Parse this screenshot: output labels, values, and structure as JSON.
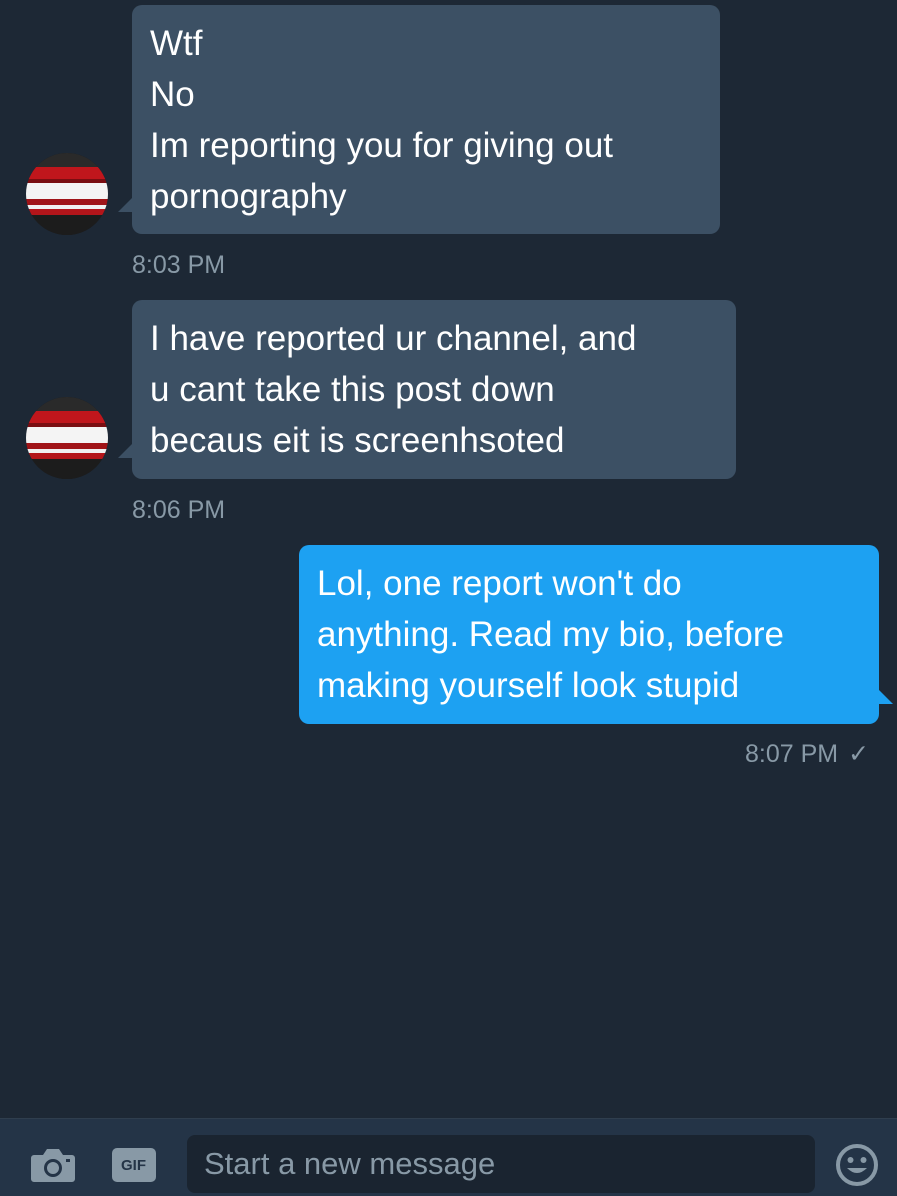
{
  "messages": [
    {
      "direction": "incoming",
      "text": "Wtf\nNo\nIm reporting you for giving out\npornography",
      "time": "8:03 PM"
    },
    {
      "direction": "incoming",
      "text": "I have reported ur channel, and\nu cant take this post down\nbecaus eit is screenhsoted",
      "time": "8:06 PM"
    },
    {
      "direction": "outgoing",
      "text": "Lol, one report won't do\nanything. Read my bio, before\nmaking yourself look stupid",
      "time": "8:07 PM",
      "status": "✓"
    }
  ],
  "composer": {
    "placeholder": "Start a new message",
    "gif_label": "GIF",
    "icons": [
      "camera-icon",
      "gif-icon",
      "emoji-icon"
    ]
  },
  "colors": {
    "background": "#1d2835",
    "incoming_bubble": "#3c5064",
    "outgoing_bubble": "#1da1f2",
    "timestamp": "#8899a6",
    "composer_bar": "#243447"
  }
}
